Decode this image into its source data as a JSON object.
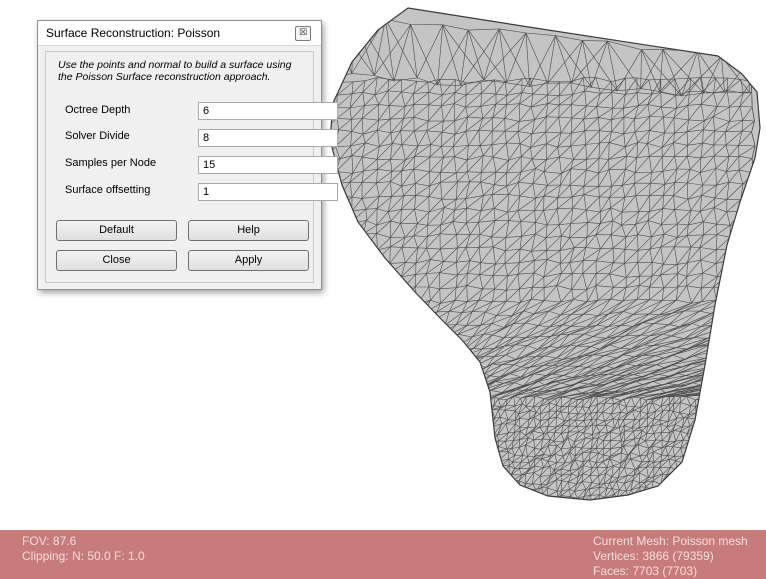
{
  "dialog": {
    "title": "Surface Reconstruction: Poisson",
    "close_glyph": "☒",
    "description_line1": "Use the points and normal to build a surface using",
    "description_line2": "the Poisson Surface reconstruction approach.",
    "params": [
      {
        "label": "Octree Depth",
        "value": "6"
      },
      {
        "label": "Solver Divide",
        "value": "8"
      },
      {
        "label": "Samples per Node",
        "value": "15"
      },
      {
        "label": "Surface offsetting",
        "value": "1"
      }
    ],
    "buttons": {
      "default": "Default",
      "help": "Help",
      "close": "Close",
      "apply": "Apply"
    }
  },
  "status": {
    "fov": "FOV: 87.6",
    "clipping": "Clipping: N:  50.0 F:  1.0",
    "current_mesh": "Current Mesh: Poisson mesh",
    "vertices": "Vertices: 3866 (79359)",
    "faces": "Faces: 7703 (7703)"
  },
  "colors": {
    "status_bar": "#c87b7b",
    "mesh_fill": "#c4c4c4",
    "mesh_wire": "#3a3a3a"
  },
  "icons": {
    "dialog_close": "close-icon"
  }
}
